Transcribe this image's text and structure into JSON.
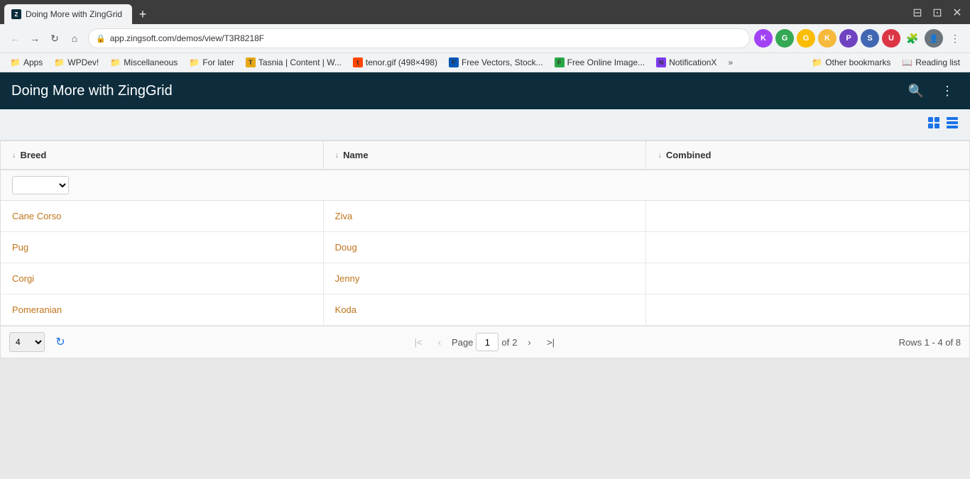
{
  "browser": {
    "url": "app.zingsoft.com/demos/view/T3R8218F",
    "tabs": [
      {
        "id": "zinggrid",
        "label": "Doing More with ZingGrid",
        "favicon_color": "#0d2d3d",
        "active": true
      },
      {
        "id": "wpdev",
        "label": "WPDev!",
        "favicon_color": "#e6a817"
      },
      {
        "id": "misc",
        "label": "Miscellaneous",
        "favicon_color": "#e6a817"
      },
      {
        "id": "forlater",
        "label": "For later",
        "favicon_color": "#e6a817"
      },
      {
        "id": "tasnia",
        "label": "Tasnia | Content | W...",
        "favicon_color": "#e6a817"
      },
      {
        "id": "tenor",
        "label": "tenor.gif (498×498)",
        "favicon_color": "#ff4500"
      },
      {
        "id": "freevectors",
        "label": "Free Vectors, Stock...",
        "favicon_color": "#0057b7"
      },
      {
        "id": "freeimage",
        "label": "Free Online Image...",
        "favicon_color": "#28a745"
      },
      {
        "id": "notifx",
        "label": "NotificationX",
        "favicon_color": "#7c3aed"
      }
    ],
    "bookmarks": [
      {
        "label": "Apps",
        "icon": "folder"
      },
      {
        "label": "WPDev!",
        "icon": "folder"
      },
      {
        "label": "Miscellaneous",
        "icon": "folder"
      },
      {
        "label": "For later",
        "icon": "folder"
      },
      {
        "label": "Tasnia | Content | W...",
        "icon": "tab"
      },
      {
        "label": "tenor.gif (498×498)",
        "icon": "tab"
      },
      {
        "label": "Free Vectors, Stock...",
        "icon": "tab"
      },
      {
        "label": "Free Online Image...",
        "icon": "tab"
      },
      {
        "label": "NotificationX",
        "icon": "tab"
      }
    ],
    "more_label": "»",
    "other_bookmarks_label": "Other bookmarks",
    "reading_list_label": "Reading list"
  },
  "app": {
    "title": "Doing More with ZingGrid",
    "search_icon": "🔍",
    "more_icon": "⋮"
  },
  "grid": {
    "columns": [
      {
        "id": "breed",
        "label": "Breed"
      },
      {
        "id": "name",
        "label": "Name"
      },
      {
        "id": "combined",
        "label": "Combined"
      }
    ],
    "rows": [
      {
        "breed": "Cane Corso",
        "name": "Ziva",
        "combined": ""
      },
      {
        "breed": "Pug",
        "name": "Doug",
        "combined": ""
      },
      {
        "breed": "Corgi",
        "name": "Jenny",
        "combined": ""
      },
      {
        "breed": "Pomeranian",
        "name": "Koda",
        "combined": ""
      }
    ],
    "pagination": {
      "page_size": "4",
      "current_page": "1",
      "total_pages": "2",
      "page_label": "Page",
      "of_label": "of",
      "rows_info": "Rows 1 - 4 of 8"
    }
  }
}
